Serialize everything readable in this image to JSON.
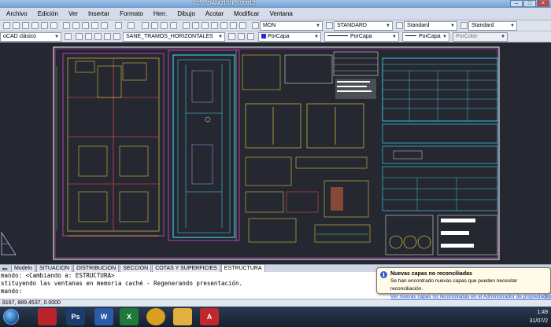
{
  "window": {
    "title": "[C:\\...\\SANO1\\01_150812"
  },
  "menu": [
    "Archivo",
    "Edición",
    "Ver",
    "Insertar",
    "Formato",
    "Herr.",
    "Dibujo",
    "Acotar",
    "Modificar",
    "Ventana"
  ],
  "toolbar": {
    "text_style": "MON",
    "dim_style": "STANDARD",
    "table_style": "Standard",
    "multileader_style": "Standard",
    "workspace": "oCAD clásico",
    "layer": "SANE_TRAMOS_HORIZONTALES",
    "color": "PorCapa",
    "linetype": "PorCapa",
    "lineweight": "PorCapa",
    "plotstyle": "PorColor"
  },
  "layout_tabs": [
    "Modelo",
    "SITUACION",
    "DISTRIBUCION",
    "SECCION",
    "COTAS Y SUPERFICIES",
    "ESTRUCTURA"
  ],
  "active_tab": "ESTRUCTURA",
  "command_line": {
    "line1": "mando: <Cambiando a: ESTRUCTURA>",
    "line2": "stituyendo las ventanas en memoria caché - Regenerando presentación.",
    "line3": "mando:"
  },
  "status": {
    "coords": ".9167, 889.4537, 0.0000"
  },
  "notification": {
    "title": "Nuevas capas no reconciliadas",
    "message": "Se han encontrado nuevas capas que pueden necesitar reconciliación.",
    "link": "Ver nuevas capas no reconciliadas en el Administrador de propiedades de"
  },
  "taskbar": {
    "apps": [
      {
        "name": "acrobat",
        "label": "",
        "color": "#b8242a"
      },
      {
        "name": "photoshop",
        "label": "Ps",
        "color": "#1b3d6b"
      },
      {
        "name": "word",
        "label": "W",
        "color": "#2a5ba8"
      },
      {
        "name": "excel",
        "label": "X",
        "color": "#1f7a3a"
      },
      {
        "name": "chrome",
        "label": "",
        "color": "#d9a020"
      },
      {
        "name": "explorer",
        "label": "",
        "color": "#e0b040"
      },
      {
        "name": "autocad",
        "label": "A",
        "color": "#c0282d"
      }
    ],
    "time": "1:49",
    "date": "31/07/2"
  },
  "colors": {
    "accent": "#2b63c7",
    "canvas": "#252831",
    "sheet_border": "#ffffff"
  }
}
